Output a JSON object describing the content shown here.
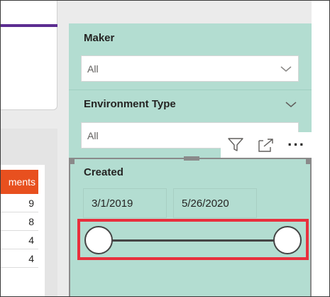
{
  "table": {
    "header": "ments",
    "rows": [
      "9",
      "8",
      "4",
      "4"
    ]
  },
  "filters": {
    "maker": {
      "label": "Maker",
      "value": "All"
    },
    "environment_type": {
      "label": "Environment Type",
      "value": "All"
    },
    "created": {
      "label": "Created",
      "start_date": "3/1/2019",
      "end_date": "5/26/2020",
      "range_start_fraction": 0,
      "range_end_fraction": 1
    }
  },
  "toolbar": {
    "icons": [
      "filter-icon",
      "focus-mode-icon",
      "more-options-icon"
    ],
    "more_label": "···"
  },
  "colors": {
    "filter_panel": "#b3ddd1",
    "table_header": "#e8501f",
    "accent": "#5c2d91",
    "highlight": "#e8303d"
  }
}
